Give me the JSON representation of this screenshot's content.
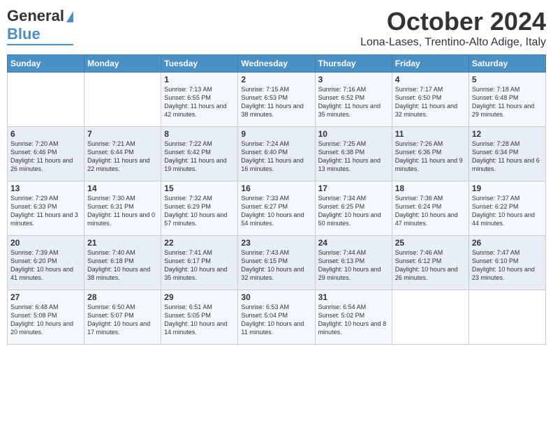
{
  "logo": {
    "part1": "General",
    "part2": "Blue"
  },
  "header": {
    "month": "October 2024",
    "location": "Lona-Lases, Trentino-Alto Adige, Italy"
  },
  "days_of_week": [
    "Sunday",
    "Monday",
    "Tuesday",
    "Wednesday",
    "Thursday",
    "Friday",
    "Saturday"
  ],
  "weeks": [
    [
      {
        "day": "",
        "sunrise": "",
        "sunset": "",
        "daylight": ""
      },
      {
        "day": "",
        "sunrise": "",
        "sunset": "",
        "daylight": ""
      },
      {
        "day": "1",
        "sunrise": "Sunrise: 7:13 AM",
        "sunset": "Sunset: 6:55 PM",
        "daylight": "Daylight: 11 hours and 42 minutes."
      },
      {
        "day": "2",
        "sunrise": "Sunrise: 7:15 AM",
        "sunset": "Sunset: 6:53 PM",
        "daylight": "Daylight: 11 hours and 38 minutes."
      },
      {
        "day": "3",
        "sunrise": "Sunrise: 7:16 AM",
        "sunset": "Sunset: 6:52 PM",
        "daylight": "Daylight: 11 hours and 35 minutes."
      },
      {
        "day": "4",
        "sunrise": "Sunrise: 7:17 AM",
        "sunset": "Sunset: 6:50 PM",
        "daylight": "Daylight: 11 hours and 32 minutes."
      },
      {
        "day": "5",
        "sunrise": "Sunrise: 7:18 AM",
        "sunset": "Sunset: 6:48 PM",
        "daylight": "Daylight: 11 hours and 29 minutes."
      }
    ],
    [
      {
        "day": "6",
        "sunrise": "Sunrise: 7:20 AM",
        "sunset": "Sunset: 6:46 PM",
        "daylight": "Daylight: 11 hours and 26 minutes."
      },
      {
        "day": "7",
        "sunrise": "Sunrise: 7:21 AM",
        "sunset": "Sunset: 6:44 PM",
        "daylight": "Daylight: 11 hours and 22 minutes."
      },
      {
        "day": "8",
        "sunrise": "Sunrise: 7:22 AM",
        "sunset": "Sunset: 6:42 PM",
        "daylight": "Daylight: 11 hours and 19 minutes."
      },
      {
        "day": "9",
        "sunrise": "Sunrise: 7:24 AM",
        "sunset": "Sunset: 6:40 PM",
        "daylight": "Daylight: 11 hours and 16 minutes."
      },
      {
        "day": "10",
        "sunrise": "Sunrise: 7:25 AM",
        "sunset": "Sunset: 6:38 PM",
        "daylight": "Daylight: 11 hours and 13 minutes."
      },
      {
        "day": "11",
        "sunrise": "Sunrise: 7:26 AM",
        "sunset": "Sunset: 6:36 PM",
        "daylight": "Daylight: 11 hours and 9 minutes."
      },
      {
        "day": "12",
        "sunrise": "Sunrise: 7:28 AM",
        "sunset": "Sunset: 6:34 PM",
        "daylight": "Daylight: 11 hours and 6 minutes."
      }
    ],
    [
      {
        "day": "13",
        "sunrise": "Sunrise: 7:29 AM",
        "sunset": "Sunset: 6:33 PM",
        "daylight": "Daylight: 11 hours and 3 minutes."
      },
      {
        "day": "14",
        "sunrise": "Sunrise: 7:30 AM",
        "sunset": "Sunset: 6:31 PM",
        "daylight": "Daylight: 11 hours and 0 minutes."
      },
      {
        "day": "15",
        "sunrise": "Sunrise: 7:32 AM",
        "sunset": "Sunset: 6:29 PM",
        "daylight": "Daylight: 10 hours and 57 minutes."
      },
      {
        "day": "16",
        "sunrise": "Sunrise: 7:33 AM",
        "sunset": "Sunset: 6:27 PM",
        "daylight": "Daylight: 10 hours and 54 minutes."
      },
      {
        "day": "17",
        "sunrise": "Sunrise: 7:34 AM",
        "sunset": "Sunset: 6:25 PM",
        "daylight": "Daylight: 10 hours and 50 minutes."
      },
      {
        "day": "18",
        "sunrise": "Sunrise: 7:36 AM",
        "sunset": "Sunset: 6:24 PM",
        "daylight": "Daylight: 10 hours and 47 minutes."
      },
      {
        "day": "19",
        "sunrise": "Sunrise: 7:37 AM",
        "sunset": "Sunset: 6:22 PM",
        "daylight": "Daylight: 10 hours and 44 minutes."
      }
    ],
    [
      {
        "day": "20",
        "sunrise": "Sunrise: 7:39 AM",
        "sunset": "Sunset: 6:20 PM",
        "daylight": "Daylight: 10 hours and 41 minutes."
      },
      {
        "day": "21",
        "sunrise": "Sunrise: 7:40 AM",
        "sunset": "Sunset: 6:18 PM",
        "daylight": "Daylight: 10 hours and 38 minutes."
      },
      {
        "day": "22",
        "sunrise": "Sunrise: 7:41 AM",
        "sunset": "Sunset: 6:17 PM",
        "daylight": "Daylight: 10 hours and 35 minutes."
      },
      {
        "day": "23",
        "sunrise": "Sunrise: 7:43 AM",
        "sunset": "Sunset: 6:15 PM",
        "daylight": "Daylight: 10 hours and 32 minutes."
      },
      {
        "day": "24",
        "sunrise": "Sunrise: 7:44 AM",
        "sunset": "Sunset: 6:13 PM",
        "daylight": "Daylight: 10 hours and 29 minutes."
      },
      {
        "day": "25",
        "sunrise": "Sunrise: 7:46 AM",
        "sunset": "Sunset: 6:12 PM",
        "daylight": "Daylight: 10 hours and 26 minutes."
      },
      {
        "day": "26",
        "sunrise": "Sunrise: 7:47 AM",
        "sunset": "Sunset: 6:10 PM",
        "daylight": "Daylight: 10 hours and 23 minutes."
      }
    ],
    [
      {
        "day": "27",
        "sunrise": "Sunrise: 6:48 AM",
        "sunset": "Sunset: 5:08 PM",
        "daylight": "Daylight: 10 hours and 20 minutes."
      },
      {
        "day": "28",
        "sunrise": "Sunrise: 6:50 AM",
        "sunset": "Sunset: 5:07 PM",
        "daylight": "Daylight: 10 hours and 17 minutes."
      },
      {
        "day": "29",
        "sunrise": "Sunrise: 6:51 AM",
        "sunset": "Sunset: 5:05 PM",
        "daylight": "Daylight: 10 hours and 14 minutes."
      },
      {
        "day": "30",
        "sunrise": "Sunrise: 6:53 AM",
        "sunset": "Sunset: 5:04 PM",
        "daylight": "Daylight: 10 hours and 11 minutes."
      },
      {
        "day": "31",
        "sunrise": "Sunrise: 6:54 AM",
        "sunset": "Sunset: 5:02 PM",
        "daylight": "Daylight: 10 hours and 8 minutes."
      },
      {
        "day": "",
        "sunrise": "",
        "sunset": "",
        "daylight": ""
      },
      {
        "day": "",
        "sunrise": "",
        "sunset": "",
        "daylight": ""
      }
    ]
  ]
}
